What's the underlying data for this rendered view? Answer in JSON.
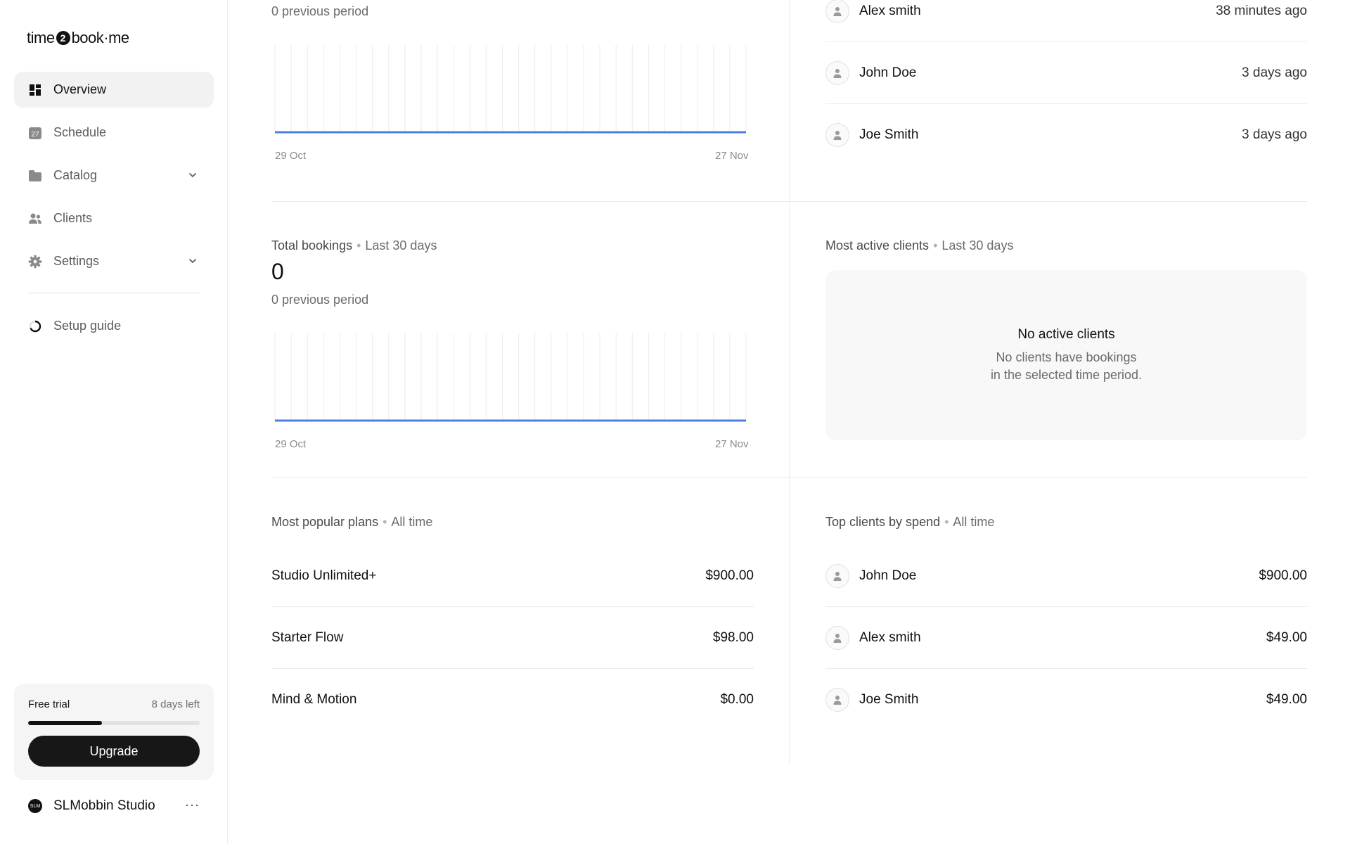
{
  "brand": {
    "part1": "time",
    "badge": "2",
    "part2": "book·me"
  },
  "sidebar": {
    "items": [
      {
        "label": "Overview",
        "icon": "grid-icon",
        "active": true
      },
      {
        "label": "Schedule",
        "icon": "calendar-icon",
        "badge": "27"
      },
      {
        "label": "Catalog",
        "icon": "folder-icon",
        "expandable": true
      },
      {
        "label": "Clients",
        "icon": "users-icon"
      },
      {
        "label": "Settings",
        "icon": "gear-icon",
        "expandable": true
      }
    ],
    "setup_label": "Setup guide",
    "trial": {
      "title": "Free trial",
      "days_left": "8 days left",
      "progress": 0.43
    },
    "upgrade_label": "Upgrade",
    "studio": {
      "initials": "SLM",
      "name": "SLMobbin Studio",
      "more": "···"
    }
  },
  "main": {
    "top_card": {
      "prev_period": "0 previous period",
      "x_start": "29 Oct",
      "x_end": "27 Nov"
    },
    "recent_clients": [
      {
        "name": "Alex smith",
        "time": "38 minutes ago"
      },
      {
        "name": "John Doe",
        "time": "3 days ago"
      },
      {
        "name": "Joe Smith",
        "time": "3 days ago"
      }
    ],
    "total_bookings": {
      "title": "Total bookings",
      "period": "Last 30 days",
      "value": "0",
      "prev_period": "0 previous period",
      "x_start": "29 Oct",
      "x_end": "27 Nov"
    },
    "most_active": {
      "title": "Most active clients",
      "period": "Last 30 days",
      "empty_title": "No active clients",
      "empty_line1": "No clients have bookings",
      "empty_line2": "in the selected time period."
    },
    "popular_plans": {
      "title": "Most popular plans",
      "period": "All time",
      "rows": [
        {
          "name": "Studio Unlimited+",
          "value": "$900.00"
        },
        {
          "name": "Starter Flow",
          "value": "$98.00"
        },
        {
          "name": "Mind & Motion",
          "value": "$0.00"
        }
      ]
    },
    "top_clients": {
      "title": "Top clients by spend",
      "period": "All time",
      "rows": [
        {
          "name": "John Doe",
          "value": "$900.00"
        },
        {
          "name": "Alex smith",
          "value": "$49.00"
        },
        {
          "name": "Joe Smith",
          "value": "$49.00"
        }
      ]
    }
  },
  "chart_data": [
    {
      "type": "line",
      "title": "",
      "x_range": [
        "29 Oct",
        "27 Nov"
      ],
      "series": [
        {
          "values": [
            0,
            0,
            0,
            0,
            0,
            0,
            0,
            0,
            0,
            0,
            0,
            0,
            0,
            0,
            0,
            0,
            0,
            0,
            0,
            0,
            0,
            0,
            0,
            0,
            0,
            0,
            0,
            0,
            0,
            0
          ]
        }
      ],
      "grid": true,
      "color": "#4a7fdc"
    },
    {
      "type": "line",
      "title": "Total bookings",
      "x_range": [
        "29 Oct",
        "27 Nov"
      ],
      "series": [
        {
          "values": [
            0,
            0,
            0,
            0,
            0,
            0,
            0,
            0,
            0,
            0,
            0,
            0,
            0,
            0,
            0,
            0,
            0,
            0,
            0,
            0,
            0,
            0,
            0,
            0,
            0,
            0,
            0,
            0,
            0,
            0
          ]
        }
      ],
      "grid": true,
      "color": "#4a7fdc"
    }
  ],
  "colors": {
    "accent_line": "#4a7fdc",
    "active_nav_bg": "#f2f2f2",
    "upgrade_bg": "#171717"
  }
}
